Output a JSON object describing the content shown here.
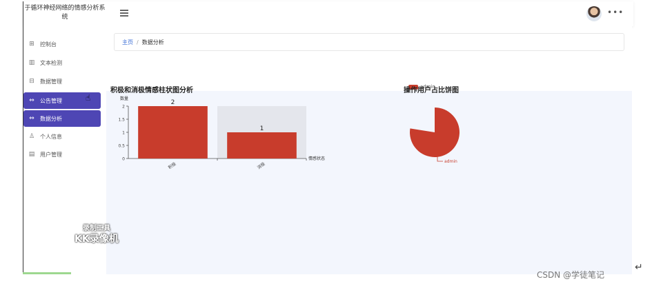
{
  "app": {
    "title_line1": "于循环神经网络的情感分析系",
    "title_line2": "统"
  },
  "sidebar": {
    "items": [
      {
        "label": "控制台",
        "icon": "dashboard-icon",
        "glyph": "⊞",
        "active": false
      },
      {
        "label": "文本检测",
        "icon": "bar-chart-icon",
        "glyph": "▥",
        "active": false
      },
      {
        "label": "数据管理",
        "icon": "table-icon",
        "glyph": "⊟",
        "active": false
      },
      {
        "label": "公告管理",
        "icon": "expand-icon",
        "glyph": "⇔",
        "active": true
      },
      {
        "label": "数据分析",
        "icon": "expand-icon",
        "glyph": "⇔",
        "active": true
      },
      {
        "label": "个人信息",
        "icon": "user-icon",
        "glyph": "♙",
        "active": false
      },
      {
        "label": "用户管理",
        "icon": "document-icon",
        "glyph": "▤",
        "active": false
      }
    ]
  },
  "breadcrumb": {
    "home": "主页",
    "separator": "/",
    "current": "数据分析"
  },
  "topbar": {
    "more": "•••"
  },
  "chart_data": [
    {
      "type": "bar",
      "title": "积极和消极情感柱状图分析",
      "ylabel": "数量",
      "xlabel": "情感状态",
      "categories": [
        "积极",
        "消极"
      ],
      "values": [
        2,
        1
      ],
      "ylim": [
        0,
        2
      ],
      "yticks": [
        "0",
        "0.5",
        "1",
        "1.5",
        "2"
      ],
      "bar_labels": [
        "2",
        "1"
      ],
      "color": "#c83c2c",
      "grid": false
    },
    {
      "type": "pie",
      "title": "操作用户占比饼图",
      "labels": [
        "admin"
      ],
      "values": [
        1
      ],
      "legend": [
        "admin"
      ],
      "color": "#c83c2c"
    }
  ],
  "watermark": {
    "line1": "录制工具",
    "line2": "KK录像机"
  },
  "footer": {
    "csdn": "CSDN @学徒笔记",
    "enter_glyph": "↵"
  }
}
